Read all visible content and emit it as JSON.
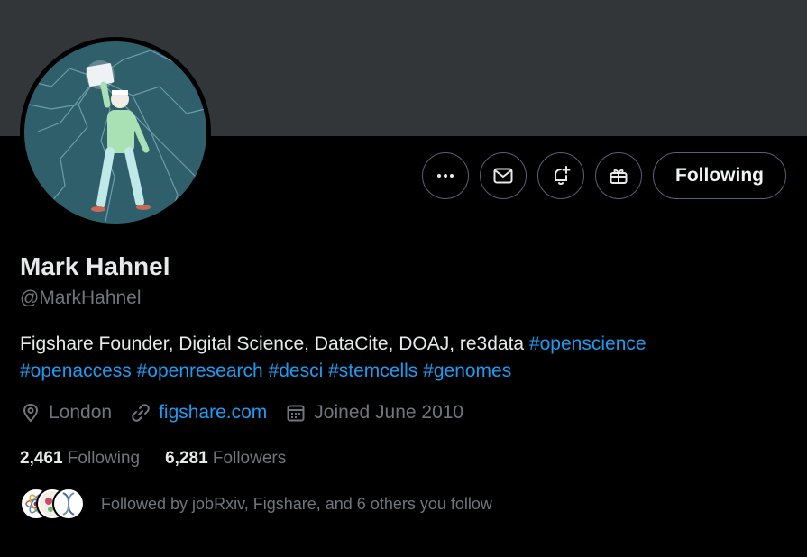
{
  "profile": {
    "name": "Mark Hahnel",
    "handle": "@MarkHahnel",
    "bio_text": "Figshare Founder, Digital Science, DataCite, DOAJ, re3data ",
    "bio_tags": [
      "#openscience",
      "#openaccess",
      "#openresearch",
      "#desci",
      "#stemcells",
      "#genomes"
    ],
    "location": "London",
    "website": "figshare.com",
    "joined": "Joined June 2010"
  },
  "actions": {
    "more_icon": "more-icon",
    "message_icon": "mail-icon",
    "notify_icon": "bell-plus-icon",
    "subscribe_icon": "gift-icon",
    "follow_label": "Following"
  },
  "stats": {
    "following_count": "2,461",
    "following_label": "Following",
    "followers_count": "6,281",
    "followers_label": "Followers"
  },
  "followed_by": {
    "text": "Followed by jobRxiv, Figshare, and 6 others you follow"
  },
  "colors": {
    "background": "#000000",
    "banner": "#333639",
    "accent": "#1d9bf0",
    "muted": "#71767b",
    "text": "#e7e9ea"
  }
}
